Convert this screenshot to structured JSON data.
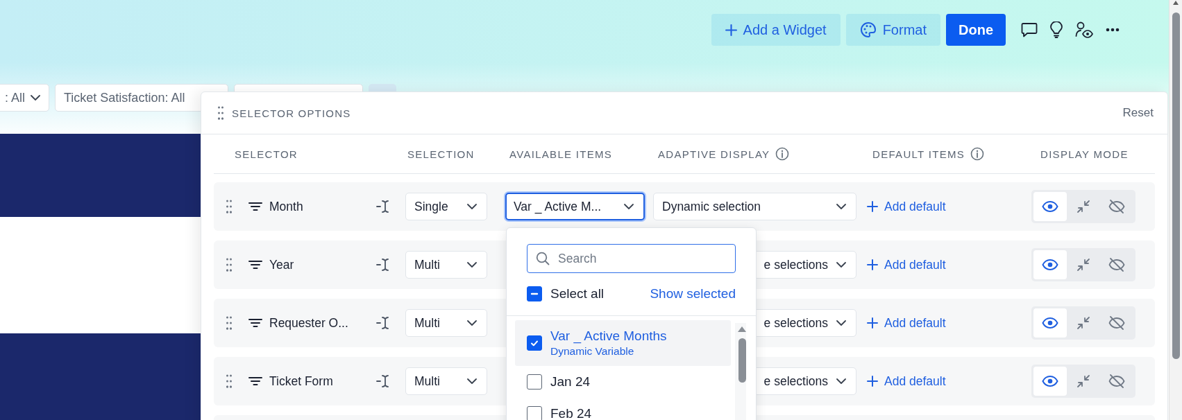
{
  "toolbar": {
    "buttons": [
      {
        "kind": "add",
        "label": "Add a Widget"
      },
      {
        "kind": "format",
        "label": "Format"
      },
      {
        "kind": "primary",
        "label": "Done"
      }
    ]
  },
  "filters": [
    {
      "label": ": All",
      "chevron": true
    },
    {
      "label": "Ticket Satisfaction: All",
      "chevron": false
    }
  ],
  "panel": {
    "title": "SELECTOR OPTIONS",
    "reset": "Reset",
    "columns": [
      {
        "label": "SELECTOR"
      },
      {
        "label": "SELECTION"
      },
      {
        "label": "AVAILABLE ITEMS"
      },
      {
        "label": "ADAPTIVE DISPLAY",
        "info": true
      },
      {
        "label": "DEFAULT ITEMS",
        "info": true
      },
      {
        "label": "DISPLAY MODE"
      }
    ],
    "rows": [
      {
        "name": "Month",
        "selection": "Single",
        "available": {
          "value": "Var _ Active M...",
          "focused": true
        },
        "adaptive": {
          "value": "Dynamic selection",
          "partly_hidden": false
        },
        "add_default": "Add default",
        "modes": [
          {
            "kind": "show",
            "selected": true
          },
          {
            "kind": "collapse",
            "selected": false
          },
          {
            "kind": "hide",
            "selected": false
          }
        ]
      },
      {
        "name": "Year",
        "selection": "Multi",
        "adaptive": {
          "value": "e selections",
          "partly_hidden": true
        },
        "add_default": "Add default",
        "modes": [
          {
            "kind": "show",
            "selected": true
          },
          {
            "kind": "collapse",
            "selected": false
          },
          {
            "kind": "hide",
            "selected": false
          }
        ]
      },
      {
        "name": "Requester O...",
        "selection": "Multi",
        "adaptive": {
          "value": "e selections",
          "partly_hidden": true
        },
        "add_default": "Add default",
        "modes": [
          {
            "kind": "show",
            "selected": true
          },
          {
            "kind": "collapse",
            "selected": false
          },
          {
            "kind": "hide",
            "selected": false
          }
        ]
      },
      {
        "name": "Ticket Form",
        "selection": "Multi",
        "adaptive": {
          "value": "e selections",
          "partly_hidden": true
        },
        "add_default": "Add default",
        "modes": [
          {
            "kind": "show",
            "selected": true
          },
          {
            "kind": "collapse",
            "selected": false
          },
          {
            "kind": "hide",
            "selected": false
          }
        ]
      }
    ],
    "popup": {
      "search_placeholder": "Search",
      "select_all": {
        "label": "Select all",
        "indeterminate": true
      },
      "show_selected": "Show selected",
      "items": [
        {
          "label": "Var _ Active Months",
          "sublabel": "Dynamic Variable",
          "checked": true,
          "selected": true
        },
        {
          "label": "Jan 24",
          "checked": false,
          "selected": false
        },
        {
          "label": "Feb 24",
          "checked": false,
          "selected": false
        }
      ]
    }
  }
}
